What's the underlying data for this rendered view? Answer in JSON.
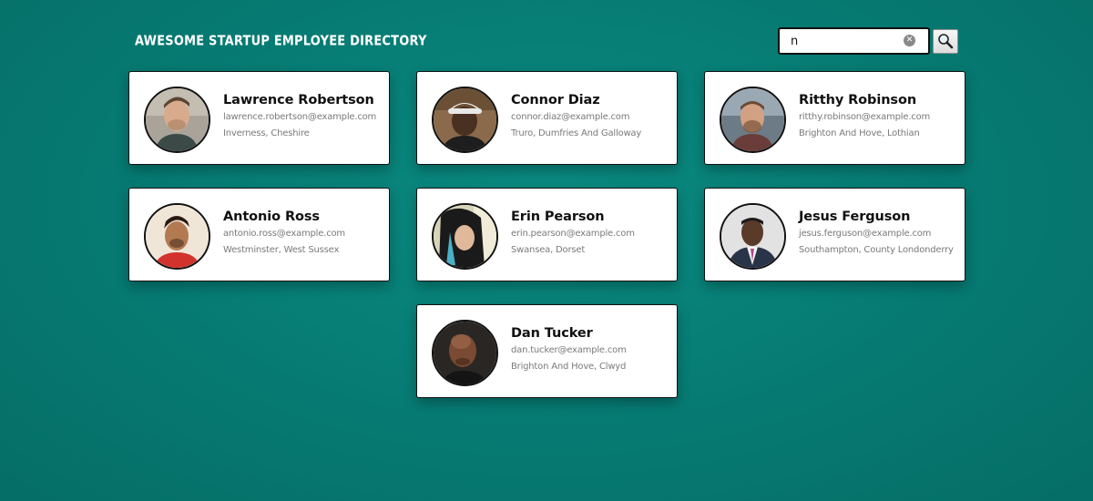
{
  "header": {
    "title": "Awesome Startup Employee Directory"
  },
  "search": {
    "value": "n",
    "clear_icon": "clear-icon",
    "button_icon": "magnifier-icon"
  },
  "employees": [
    {
      "name": "Lawrence Robertson",
      "email": "lawrence.robertson@example.com",
      "location": "Inverness, Cheshire"
    },
    {
      "name": "Connor Diaz",
      "email": "connor.diaz@example.com",
      "location": "Truro, Dumfries And Galloway"
    },
    {
      "name": "Ritthy Robinson",
      "email": "ritthy.robinson@example.com",
      "location": "Brighton And Hove, Lothian"
    },
    {
      "name": "Antonio Ross",
      "email": "antonio.ross@example.com",
      "location": "Westminster, West Sussex"
    },
    {
      "name": "Erin Pearson",
      "email": "erin.pearson@example.com",
      "location": "Swansea, Dorset"
    },
    {
      "name": "Jesus Ferguson",
      "email": "jesus.ferguson@example.com",
      "location": "Southampton, County Londonderry"
    },
    {
      "name": "Dan Tucker",
      "email": "dan.tucker@example.com",
      "location": "Brighton And Hove, Clwyd"
    }
  ]
}
